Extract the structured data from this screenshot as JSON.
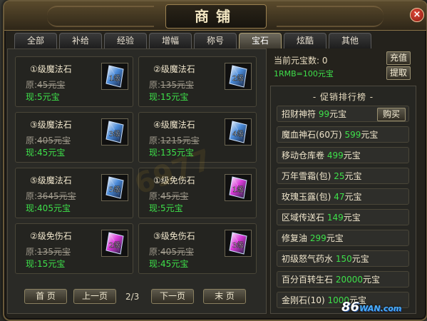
{
  "window": {
    "title": "商铺",
    "close_label": "×"
  },
  "tabs": [
    {
      "label": "全部",
      "active": false
    },
    {
      "label": "补给",
      "active": false
    },
    {
      "label": "经验",
      "active": false
    },
    {
      "label": "增幅",
      "active": false
    },
    {
      "label": "称号",
      "active": false
    },
    {
      "label": "宝石",
      "active": true
    },
    {
      "label": "炫酷",
      "active": false
    },
    {
      "label": "其他",
      "active": false
    }
  ],
  "items": [
    {
      "name": "①级魔法石",
      "orig_label": "原:",
      "orig_price": "45元宝",
      "now_label": "现:",
      "now_price": "5元宝",
      "gem_label": "1级",
      "gem_color": "#4a8ad8"
    },
    {
      "name": "②级魔法石",
      "orig_label": "原:",
      "orig_price": "135元宝",
      "now_label": "现:",
      "now_price": "15元宝",
      "gem_label": "2级",
      "gem_color": "#4a8ad8"
    },
    {
      "name": "③级魔法石",
      "orig_label": "原:",
      "orig_price": "405元宝",
      "now_label": "现:",
      "now_price": "45元宝",
      "gem_label": "3级",
      "gem_color": "#4a8ad8"
    },
    {
      "name": "④级魔法石",
      "orig_label": "原:",
      "orig_price": "1215元宝",
      "now_label": "现:",
      "now_price": "135元宝",
      "gem_label": "4级",
      "gem_color": "#4a8ad8"
    },
    {
      "name": "⑤级魔法石",
      "orig_label": "原:",
      "orig_price": "3645元宝",
      "now_label": "现:",
      "now_price": "405元宝",
      "gem_label": "5级",
      "gem_color": "#4a8ad8"
    },
    {
      "name": "①级免伤石",
      "orig_label": "原:",
      "orig_price": "45元宝",
      "now_label": "现:",
      "now_price": "5元宝",
      "gem_label": "1级",
      "gem_color": "#d83ad8"
    },
    {
      "name": "②级免伤石",
      "orig_label": "原:",
      "orig_price": "135元宝",
      "now_label": "现:",
      "now_price": "15元宝",
      "gem_label": "2级",
      "gem_color": "#d83ad8"
    },
    {
      "name": "③级免伤石",
      "orig_label": "原:",
      "orig_price": "405元宝",
      "now_label": "现:",
      "now_price": "45元宝",
      "gem_label": "3级",
      "gem_color": "#d83ad8"
    }
  ],
  "pager": {
    "first": "首 页",
    "prev": "上一页",
    "info": "2/3",
    "next": "下一页",
    "last": "末 页"
  },
  "account": {
    "balance": "当前元宝数: 0",
    "rate": "1RMB=100元宝",
    "recharge": "充值",
    "withdraw": "提取"
  },
  "promo": {
    "title": "- 促销排行榜 -",
    "buy_label": "购买",
    "rows": [
      {
        "name": "招财神符 ",
        "price": "99",
        "unit": "元宝"
      },
      {
        "name": "魔血神石(60万) ",
        "price": "599",
        "unit": "元宝"
      },
      {
        "name": "移动仓库卷 ",
        "price": "499",
        "unit": "元宝"
      },
      {
        "name": "万年雪霜(包) ",
        "price": "25",
        "unit": "元宝"
      },
      {
        "name": "玫瑰玉露(包) ",
        "price": "47",
        "unit": "元宝"
      },
      {
        "name": "区域传送石 ",
        "price": "149",
        "unit": "元宝"
      },
      {
        "name": "修复油 ",
        "price": "299",
        "unit": "元宝"
      },
      {
        "name": "初级怒气药水 ",
        "price": "150",
        "unit": "元宝"
      },
      {
        "name": "百分百转生石 ",
        "price": "20000",
        "unit": "元宝"
      },
      {
        "name": "金刚石(10) ",
        "price": "1000",
        "unit": "元宝"
      }
    ]
  },
  "logo": {
    "main": "86",
    "sub": "WAN.com"
  }
}
